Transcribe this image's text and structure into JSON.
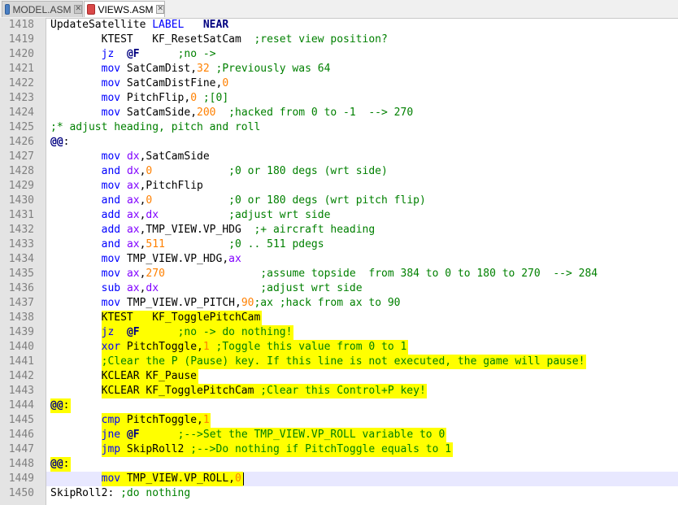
{
  "tabs": [
    {
      "label": "MODEL.ASM",
      "active": false,
      "icon": "floppy-disk-icon",
      "icon_color": "#4a7fc4"
    },
    {
      "label": "VIEWS.ASM",
      "active": true,
      "icon": "floppy-disk-unsaved-icon",
      "icon_color": "#d94848"
    }
  ],
  "colors": {
    "highlight": "#ffff00",
    "current_line": "#e8e8ff",
    "keyword": "#0000ff",
    "number": "#ff8000",
    "comment": "#008000",
    "register": "#8000ff",
    "line_number": "#808080"
  },
  "lines": [
    {
      "num": "1418",
      "tokens": [
        [
          "id",
          "UpdateSatellite "
        ],
        [
          "lbl",
          "LABEL"
        ],
        [
          "id",
          "   "
        ],
        [
          "dir",
          "NEAR"
        ]
      ]
    },
    {
      "num": "1419",
      "tokens": [
        [
          "id",
          "        KTEST   KF_ResetSatCam  "
        ],
        [
          "cm",
          ";reset view position?"
        ]
      ]
    },
    {
      "num": "1420",
      "tokens": [
        [
          "id",
          "        "
        ],
        [
          "kw",
          "jz"
        ],
        [
          "id",
          "  "
        ],
        [
          "dir",
          "@F"
        ],
        [
          "id",
          "      "
        ],
        [
          "cm",
          ";no ->"
        ]
      ]
    },
    {
      "num": "1421",
      "tokens": [
        [
          "id",
          "        "
        ],
        [
          "kw",
          "mov"
        ],
        [
          "id",
          " SatCamDist,"
        ],
        [
          "num",
          "32"
        ],
        [
          "id",
          " "
        ],
        [
          "cm",
          ";Previously was 64"
        ]
      ]
    },
    {
      "num": "1422",
      "tokens": [
        [
          "id",
          "        "
        ],
        [
          "kw",
          "mov"
        ],
        [
          "id",
          " SatCamDistFine,"
        ],
        [
          "num",
          "0"
        ]
      ]
    },
    {
      "num": "1423",
      "tokens": [
        [
          "id",
          "        "
        ],
        [
          "kw",
          "mov"
        ],
        [
          "id",
          " PitchFlip,"
        ],
        [
          "num",
          "0"
        ],
        [
          "id",
          " "
        ],
        [
          "cm",
          ";[0]"
        ]
      ]
    },
    {
      "num": "1424",
      "tokens": [
        [
          "id",
          "        "
        ],
        [
          "kw",
          "mov"
        ],
        [
          "id",
          " SatCamSide,"
        ],
        [
          "num",
          "200"
        ],
        [
          "id",
          "  "
        ],
        [
          "cm",
          ";hacked from 0 to -1  --> 270"
        ]
      ]
    },
    {
      "num": "1425",
      "tokens": [
        [
          "cm",
          ";* adjust heading, pitch and roll"
        ]
      ]
    },
    {
      "num": "1426",
      "tokens": [
        [
          "dir",
          "@@"
        ],
        [
          "id",
          ":"
        ]
      ]
    },
    {
      "num": "1427",
      "tokens": [
        [
          "id",
          "        "
        ],
        [
          "kw",
          "mov"
        ],
        [
          "id",
          " "
        ],
        [
          "reg",
          "dx"
        ],
        [
          "id",
          ",SatCamSide"
        ]
      ]
    },
    {
      "num": "1428",
      "tokens": [
        [
          "id",
          "        "
        ],
        [
          "kw",
          "and"
        ],
        [
          "id",
          " "
        ],
        [
          "reg",
          "dx"
        ],
        [
          "id",
          ","
        ],
        [
          "num",
          "0"
        ],
        [
          "id",
          "            "
        ],
        [
          "cm",
          ";0 or 180 degs (wrt side)"
        ]
      ]
    },
    {
      "num": "1429",
      "tokens": [
        [
          "id",
          "        "
        ],
        [
          "kw",
          "mov"
        ],
        [
          "id",
          " "
        ],
        [
          "reg",
          "ax"
        ],
        [
          "id",
          ",PitchFlip"
        ]
      ]
    },
    {
      "num": "1430",
      "tokens": [
        [
          "id",
          "        "
        ],
        [
          "kw",
          "and"
        ],
        [
          "id",
          " "
        ],
        [
          "reg",
          "ax"
        ],
        [
          "id",
          ","
        ],
        [
          "num",
          "0"
        ],
        [
          "id",
          "            "
        ],
        [
          "cm",
          ";0 or 180 degs (wrt pitch flip)"
        ]
      ]
    },
    {
      "num": "1431",
      "tokens": [
        [
          "id",
          "        "
        ],
        [
          "kw",
          "add"
        ],
        [
          "id",
          " "
        ],
        [
          "reg",
          "ax"
        ],
        [
          "id",
          ","
        ],
        [
          "reg",
          "dx"
        ],
        [
          "id",
          "           "
        ],
        [
          "cm",
          ";adjust wrt side"
        ]
      ]
    },
    {
      "num": "1432",
      "tokens": [
        [
          "id",
          "        "
        ],
        [
          "kw",
          "add"
        ],
        [
          "id",
          " "
        ],
        [
          "reg",
          "ax"
        ],
        [
          "id",
          ",TMP_VIEW.VP_HDG  "
        ],
        [
          "cm",
          ";+ aircraft heading"
        ]
      ]
    },
    {
      "num": "1433",
      "tokens": [
        [
          "id",
          "        "
        ],
        [
          "kw",
          "and"
        ],
        [
          "id",
          " "
        ],
        [
          "reg",
          "ax"
        ],
        [
          "id",
          ","
        ],
        [
          "num",
          "511"
        ],
        [
          "id",
          "          "
        ],
        [
          "cm",
          ";0 .. 511 pdegs"
        ]
      ]
    },
    {
      "num": "1434",
      "tokens": [
        [
          "id",
          "        "
        ],
        [
          "kw",
          "mov"
        ],
        [
          "id",
          " TMP_VIEW.VP_HDG,"
        ],
        [
          "reg",
          "ax"
        ]
      ]
    },
    {
      "num": "1435",
      "tokens": [
        [
          "id",
          "        "
        ],
        [
          "kw",
          "mov"
        ],
        [
          "id",
          " "
        ],
        [
          "reg",
          "ax"
        ],
        [
          "id",
          ","
        ],
        [
          "num",
          "270"
        ],
        [
          "id",
          "               "
        ],
        [
          "cm",
          ";assume topside  from 384 to 0 to 180 to 270  --> 284"
        ]
      ]
    },
    {
      "num": "1436",
      "tokens": [
        [
          "id",
          "        "
        ],
        [
          "kw",
          "sub"
        ],
        [
          "id",
          " "
        ],
        [
          "reg",
          "ax"
        ],
        [
          "id",
          ","
        ],
        [
          "reg",
          "dx"
        ],
        [
          "id",
          "                "
        ],
        [
          "cm",
          ";adjust wrt side"
        ]
      ]
    },
    {
      "num": "1437",
      "tokens": [
        [
          "id",
          "        "
        ],
        [
          "kw",
          "mov"
        ],
        [
          "id",
          " TMP_VIEW.VP_PITCH,"
        ],
        [
          "num",
          "90"
        ],
        [
          "cm",
          ";ax ;hack from ax to 90"
        ]
      ]
    },
    {
      "num": "1438",
      "hl": true,
      "tokens": [
        [
          "id",
          "        KTEST   KF_TogglePitchCam"
        ]
      ]
    },
    {
      "num": "1439",
      "hl": true,
      "tokens": [
        [
          "id",
          "        "
        ],
        [
          "kw",
          "jz"
        ],
        [
          "id",
          "  "
        ],
        [
          "dir",
          "@F"
        ],
        [
          "id",
          "      "
        ],
        [
          "cm",
          ";no -> do nothing!"
        ]
      ]
    },
    {
      "num": "1440",
      "hl": true,
      "tokens": [
        [
          "id",
          "        "
        ],
        [
          "kw",
          "xor"
        ],
        [
          "id",
          " PitchToggle,"
        ],
        [
          "num",
          "1"
        ],
        [
          "id",
          " "
        ],
        [
          "cm",
          ";Toggle this value from 0 to 1"
        ]
      ]
    },
    {
      "num": "1441",
      "hl": true,
      "tokens": [
        [
          "id",
          "        "
        ],
        [
          "cm",
          ";Clear the P (Pause) key. If this line is not executed, the game will pause!"
        ]
      ]
    },
    {
      "num": "1442",
      "hl": true,
      "tokens": [
        [
          "id",
          "        KCLEAR KF_Pause"
        ]
      ]
    },
    {
      "num": "1443",
      "hl": true,
      "tokens": [
        [
          "id",
          "        KCLEAR KF_TogglePitchCam "
        ],
        [
          "cm",
          ";Clear this Control+P key!"
        ]
      ]
    },
    {
      "num": "1444",
      "hl": true,
      "tokens": [
        [
          "dir",
          "@@"
        ],
        [
          "id",
          ":"
        ]
      ]
    },
    {
      "num": "1445",
      "hl": true,
      "tokens": [
        [
          "id",
          "        "
        ],
        [
          "kw",
          "cmp"
        ],
        [
          "id",
          " PitchToggle,"
        ],
        [
          "num",
          "1"
        ]
      ]
    },
    {
      "num": "1446",
      "hl": true,
      "tokens": [
        [
          "id",
          "        "
        ],
        [
          "kw",
          "jne"
        ],
        [
          "id",
          " "
        ],
        [
          "dir",
          "@F"
        ],
        [
          "id",
          "      "
        ],
        [
          "cm",
          ";-->Set the TMP_VIEW.VP_ROLL variable to 0"
        ]
      ]
    },
    {
      "num": "1447",
      "hl": true,
      "tokens": [
        [
          "id",
          "        "
        ],
        [
          "kw",
          "jmp"
        ],
        [
          "id",
          " SkipRoll2 "
        ],
        [
          "cm",
          ";-->Do nothing if PitchToggle equals to 1"
        ]
      ]
    },
    {
      "num": "1448",
      "hl": true,
      "tokens": [
        [
          "dir",
          "@@"
        ],
        [
          "id",
          ":"
        ]
      ]
    },
    {
      "num": "1449",
      "hl": true,
      "current": true,
      "tokens": [
        [
          "id",
          "        "
        ],
        [
          "kw",
          "mov"
        ],
        [
          "id",
          " TMP_VIEW.VP_ROLL,"
        ],
        [
          "num",
          "0"
        ]
      ]
    },
    {
      "num": "1450",
      "tokens": [
        [
          "id",
          "SkipRoll2: "
        ],
        [
          "cm",
          ";do nothing"
        ]
      ]
    }
  ]
}
